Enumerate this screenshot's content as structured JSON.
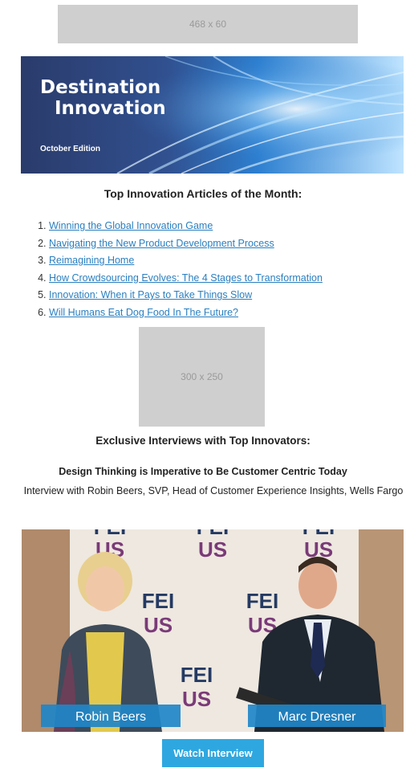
{
  "ads": {
    "top_label": "468 x 60",
    "mid_label": "300 x 250"
  },
  "banner": {
    "title_line1": "Destination",
    "title_line2": "Innovation",
    "edition": "October Edition"
  },
  "articles": {
    "heading": "Top Innovation Articles of the Month:",
    "items": [
      {
        "number": "1.",
        "label": "Winning the Global Innovation Game"
      },
      {
        "number": "2.",
        "label": "Navigating the New Product Development Process"
      },
      {
        "number": "3.",
        "label": "Reimagining Home"
      },
      {
        "number": "4.",
        "label": "How Crowdsourcing Evolves: The 4 Stages to Transformation"
      },
      {
        "number": "5.",
        "label": "Innovation: When it Pays to Take Things Slow"
      },
      {
        "number": "6.",
        "label": "Will Humans Eat Dog Food In The Future?"
      }
    ]
  },
  "interviews": {
    "heading": "Exclusive Interviews with Top Innovators:",
    "title": "Design Thinking is Imperative to Be Customer Centric Today",
    "description": "Interview with Robin Beers, SVP, Head of Customer Experience Insights, Wells Fargo",
    "video": {
      "backdrop_line1": "FEI",
      "backdrop_line2": "US",
      "left_name": "Robin Beers",
      "right_name": "Marc Dresner"
    },
    "button_label": "Watch Interview"
  },
  "colors": {
    "link": "#2a7fc0",
    "button": "#2ea7e0",
    "name_bar": "#1f86c8",
    "backdrop_purple": "#7a3a78",
    "backdrop_navy": "#243a63"
  }
}
